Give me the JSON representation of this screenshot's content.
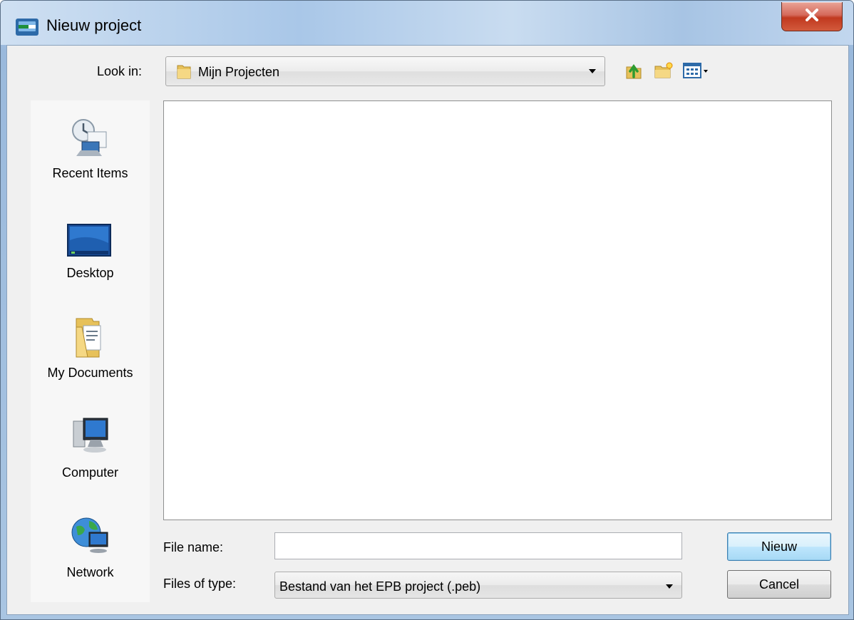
{
  "window": {
    "title": "Nieuw project",
    "close_icon": "close-icon"
  },
  "toolbar": {
    "look_in_label": "Look in:",
    "look_in_value": "Mijn Projecten",
    "icons": [
      "up-folder-icon",
      "new-folder-icon",
      "view-menu-icon"
    ]
  },
  "places": [
    {
      "label": "Recent Items",
      "icon": "recent-items-icon"
    },
    {
      "label": "Desktop",
      "icon": "desktop-icon"
    },
    {
      "label": "My Documents",
      "icon": "my-documents-icon"
    },
    {
      "label": "Computer",
      "icon": "computer-icon"
    },
    {
      "label": "Network",
      "icon": "network-icon"
    }
  ],
  "form": {
    "file_name_label": "File name:",
    "file_name_value": "",
    "files_of_type_label": "Files of type:",
    "files_of_type_value": "Bestand van het EPB project (.peb)"
  },
  "buttons": {
    "primary_label": "Nieuw",
    "cancel_label": "Cancel"
  },
  "colors": {
    "title_gradient": "#a9c7e8",
    "close_red": "#c1391f",
    "primary_button": "#bee6fd"
  }
}
